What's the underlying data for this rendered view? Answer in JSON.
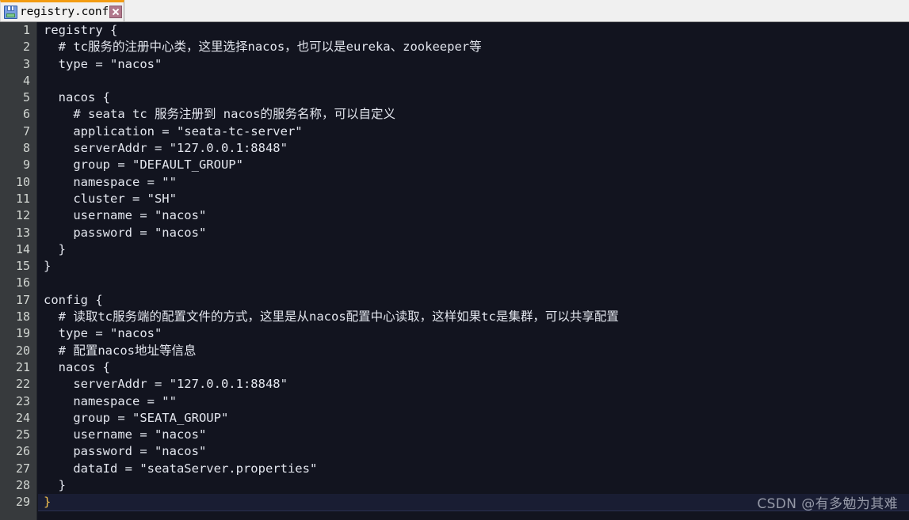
{
  "window": {
    "title": "registry.conf"
  },
  "tabbar": {
    "tabs": [
      {
        "label": "registry.conf",
        "icon": "save-floppy-icon",
        "close_label": "×",
        "active": true,
        "accent_color": "#f39c12"
      }
    ]
  },
  "editor": {
    "background_color": "#12141f",
    "gutter_color": "#373a3d",
    "text_color": "#e3e6ee",
    "active_line": 29,
    "active_line_color": "#191d33",
    "matching_brace_color": "#f2c14e",
    "total_lines": 29,
    "lines": [
      {
        "n": "1",
        "text": "registry {"
      },
      {
        "n": "2",
        "text": "  # tc服务的注册中心类，这里选择nacos，也可以是eureka、zookeeper等"
      },
      {
        "n": "3",
        "text": "  type = \"nacos\""
      },
      {
        "n": "4",
        "text": ""
      },
      {
        "n": "5",
        "text": "  nacos {"
      },
      {
        "n": "6",
        "text": "    # seata tc 服务注册到 nacos的服务名称，可以自定义"
      },
      {
        "n": "7",
        "text": "    application = \"seata-tc-server\""
      },
      {
        "n": "8",
        "text": "    serverAddr = \"127.0.0.1:8848\""
      },
      {
        "n": "9",
        "text": "    group = \"DEFAULT_GROUP\""
      },
      {
        "n": "10",
        "text": "    namespace = \"\""
      },
      {
        "n": "11",
        "text": "    cluster = \"SH\""
      },
      {
        "n": "12",
        "text": "    username = \"nacos\""
      },
      {
        "n": "13",
        "text": "    password = \"nacos\""
      },
      {
        "n": "14",
        "text": "  }"
      },
      {
        "n": "15",
        "text": "}"
      },
      {
        "n": "16",
        "text": ""
      },
      {
        "n": "17",
        "text": "config {"
      },
      {
        "n": "18",
        "text": "  # 读取tc服务端的配置文件的方式，这里是从nacos配置中心读取，这样如果tc是集群，可以共享配置"
      },
      {
        "n": "19",
        "text": "  type = \"nacos\""
      },
      {
        "n": "20",
        "text": "  # 配置nacos地址等信息"
      },
      {
        "n": "21",
        "text": "  nacos {"
      },
      {
        "n": "22",
        "text": "    serverAddr = \"127.0.0.1:8848\""
      },
      {
        "n": "23",
        "text": "    namespace = \"\""
      },
      {
        "n": "24",
        "text": "    group = \"SEATA_GROUP\""
      },
      {
        "n": "25",
        "text": "    username = \"nacos\""
      },
      {
        "n": "26",
        "text": "    password = \"nacos\""
      },
      {
        "n": "27",
        "text": "    dataId = \"seataServer.properties\""
      },
      {
        "n": "28",
        "text": "  }"
      },
      {
        "n": "29",
        "text": "}",
        "active": true,
        "brace_highlight": true
      }
    ]
  },
  "watermark": {
    "text": "CSDN @有多勉为其难"
  }
}
